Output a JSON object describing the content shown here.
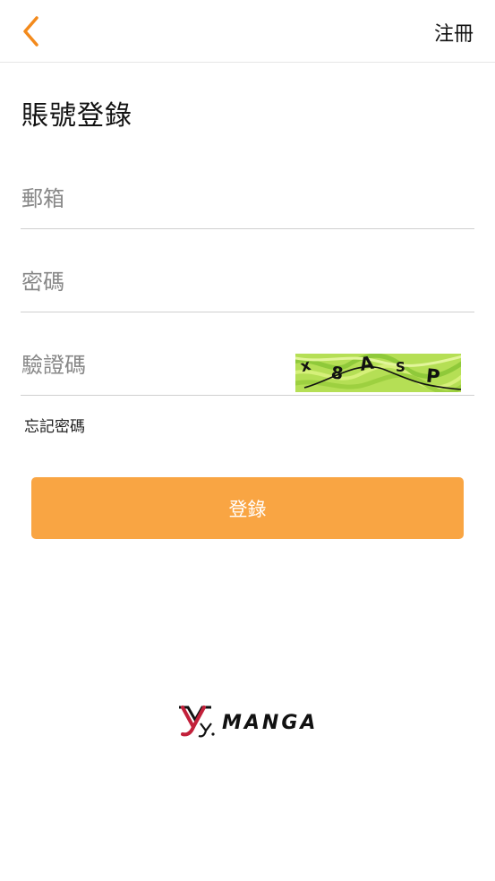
{
  "nav": {
    "back_icon": "chevron-left-icon",
    "register_label": "注冊",
    "accent_color": "#f38a1c"
  },
  "page_title": "賬號登錄",
  "form": {
    "email_placeholder": "郵箱",
    "password_placeholder": "密碼",
    "captcha_placeholder": "驗證碼",
    "captcha_image_text": "x8ASP",
    "forgot_password_label": "忘記密碼",
    "login_button_label": "登錄",
    "login_button_color": "#f9a543"
  },
  "footer_logo": {
    "text": "MANGA"
  }
}
